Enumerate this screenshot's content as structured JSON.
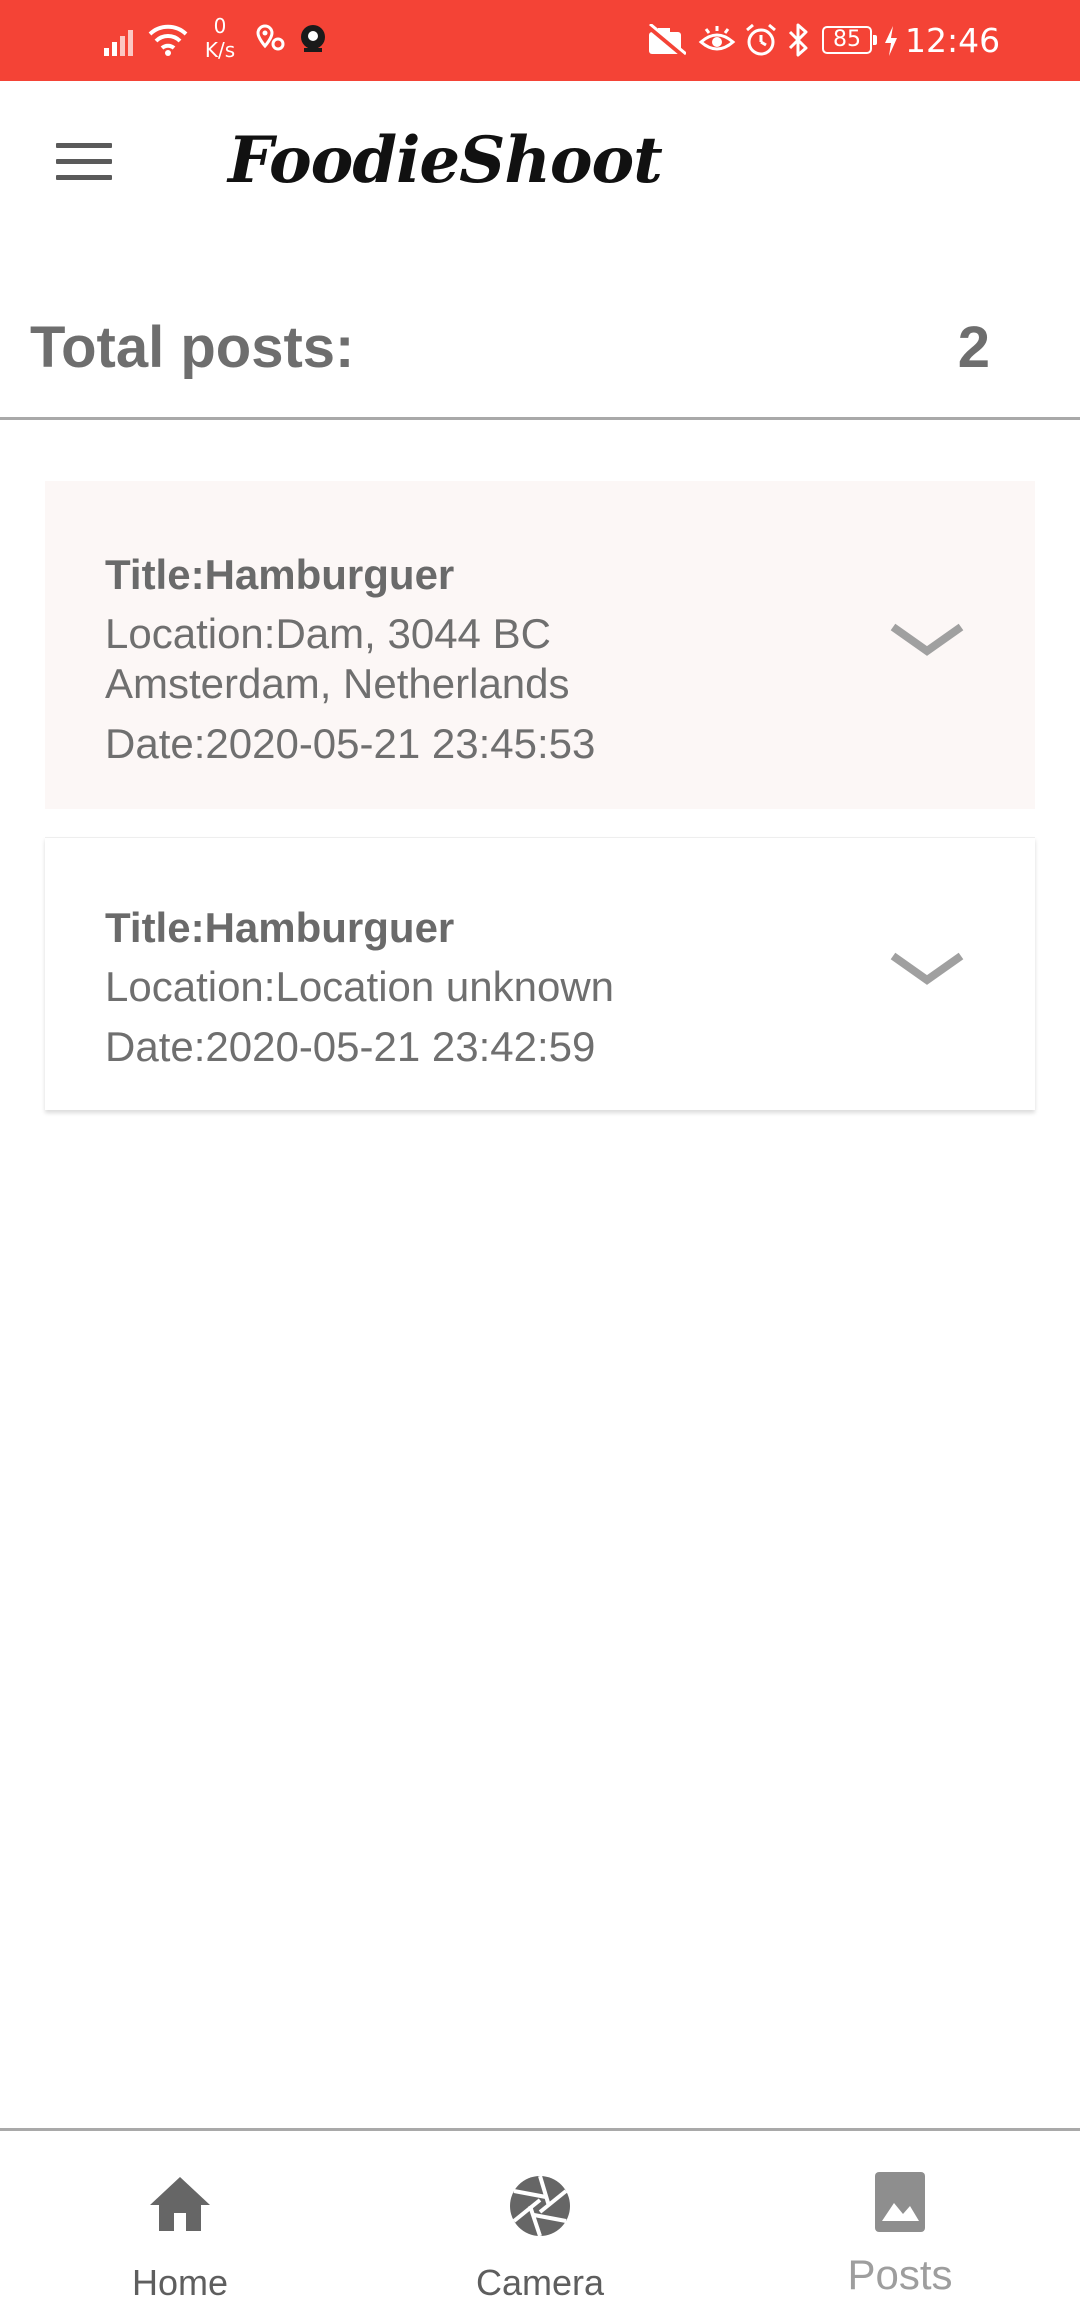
{
  "status_bar": {
    "net_speed_value": "0",
    "net_speed_unit": "K/s",
    "battery": "85",
    "time": "12:46",
    "background": "#f44336"
  },
  "app_bar": {
    "logo_text": "FoodieShoot",
    "menu_icon": "hamburger-menu-icon"
  },
  "summary": {
    "label": "Total posts:",
    "count": "2"
  },
  "posts": [
    {
      "title": "Title:Hamburguer",
      "location_line1": "Location:Dam, 3044 BC",
      "location_line2": "Amsterdam, Netherlands",
      "date": "Date:2020-05-21 23:45:53",
      "expand_icon": "chevron-down-icon",
      "highlighted": true
    },
    {
      "title": "Title:Hamburguer",
      "location_line1": "Location:Location unknown",
      "date": "Date:2020-05-21 23:42:59",
      "expand_icon": "chevron-down-icon",
      "highlighted": false
    }
  ],
  "bottom_nav": {
    "items": [
      {
        "label": "Home",
        "icon": "home-icon",
        "active": false
      },
      {
        "label": "Camera",
        "icon": "camera-aperture-icon",
        "active": false
      },
      {
        "label": "Posts",
        "icon": "image-icon",
        "active": true
      }
    ]
  },
  "colors": {
    "accent": "#f44336",
    "text": "#6f6f6f",
    "card_highlight": "#fcf7f6",
    "divider": "#a9a9a9"
  }
}
